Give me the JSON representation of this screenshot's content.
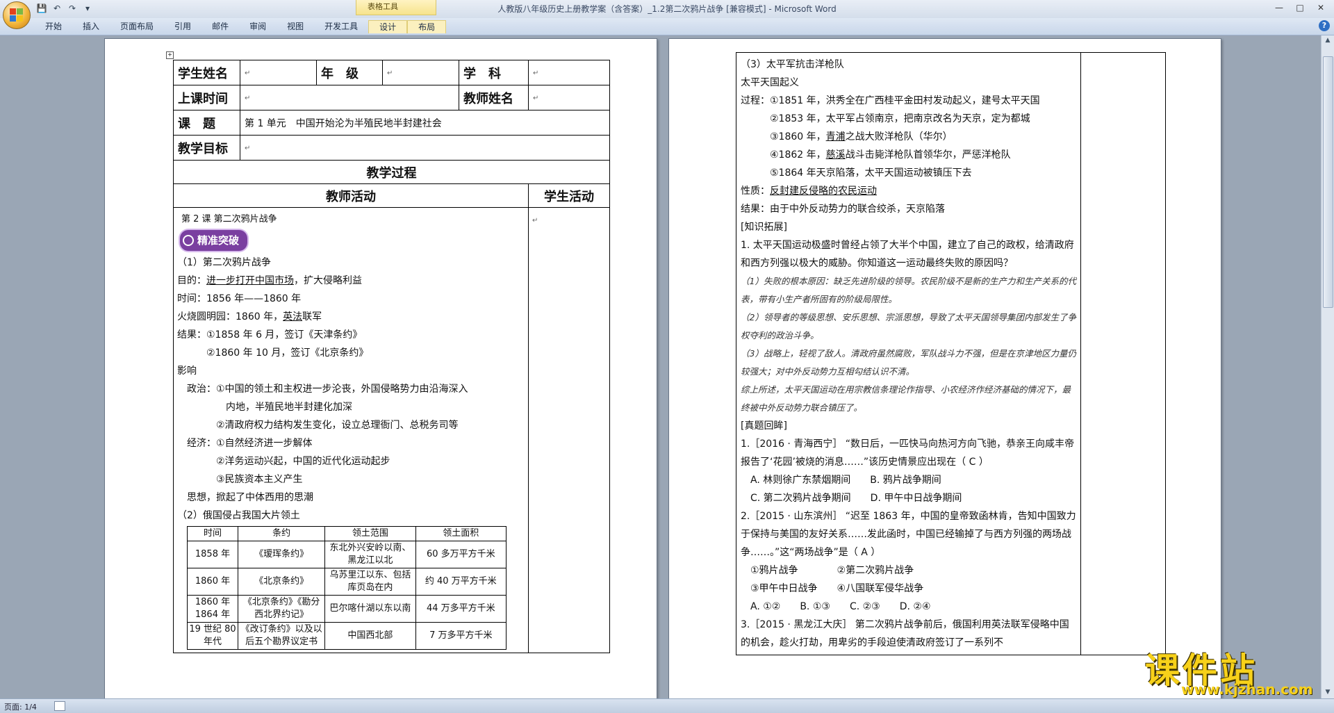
{
  "window": {
    "title": "人教版八年级历史上册教学案（含答案）_1.2第二次鸦片战争 [兼容模式] - Microsoft Word",
    "context_tab_group": "表格工具",
    "controls": [
      "—",
      "□",
      "✕"
    ]
  },
  "ribbon": {
    "tabs": [
      "开始",
      "插入",
      "页面布局",
      "引用",
      "邮件",
      "审阅",
      "视图",
      "开发工具"
    ],
    "context_tabs": [
      "设计",
      "布局"
    ]
  },
  "qat": {
    "save": "💾",
    "undo": "↶",
    "redo": "↷",
    "more": "▾"
  },
  "status": {
    "page": "页面: 1/4"
  },
  "page1": {
    "student_name_label": "学生姓名",
    "grade_label": "年　级",
    "subject_label": "学　科",
    "class_time_label": "上课时间",
    "teacher_name_label": "教师姓名",
    "topic_label": "课　题",
    "topic_value": "第 1 单元　中国开始沦为半殖民地半封建社会",
    "goal_label": "教学目标",
    "process_title": "教学过程",
    "teacher_activity": "教师活动",
    "student_activity": "学生活动",
    "lesson_title": "第 2 课 第二次鸦片战争",
    "badge": "精准突破",
    "lines": {
      "s1": "（1）第二次鸦片战争",
      "purpose_pre": "目的：",
      "purpose_u": "进一步打开中国市场",
      "purpose_post": "，扩大侵略利益",
      "time": "时间：1856 年——1860 年",
      "burn_pre": "火烧圆明园：1860 年，",
      "burn_u": "英法",
      "burn_post": "联军",
      "res1": "结果：①1858 年 6 月，签订《天津条约》",
      "res2": "②1860 年 10 月，签订《北京条约》",
      "impact": "影响",
      "pol1": "政治：①中国的领土和主权进一步沦丧，外国侵略势力由沿海深入",
      "pol1b": "内地，半殖民地半封建化加深",
      "pol2": "②清政府权力结构发生变化，设立总理衙门、总税务司等",
      "eco1": "经济：①自然经济进一步解体",
      "eco2": "②洋务运动兴起，中国的近代化运动起步",
      "eco3": "③民族资本主义产生",
      "thought": "思想，掀起了中体西用的思潮",
      "s2": "（2）俄国侵占我国大片领土"
    },
    "table_headers": [
      "时间",
      "条约",
      "领土范围",
      "领土面积"
    ],
    "table_rows": [
      {
        "time": "1858 年",
        "treaty": "《瑷珲条约》",
        "range": "东北外兴安岭以南、黑龙江以北",
        "area": "60 多万平方千米"
      },
      {
        "time": "1860 年",
        "treaty": "《北京条约》",
        "range": "乌苏里江以东、包括库页岛在内",
        "area": "约 40 万平方千米"
      },
      {
        "time": "1860 年 1864 年",
        "treaty": "《北京条约》《勘分西北界约记》",
        "range": "巴尔喀什湖以东以南",
        "area": "44 万多平方千米"
      },
      {
        "time": "19 世纪 80 年代",
        "treaty": "《改订条约》以及以后五个勘界议定书",
        "range": "中国西北部",
        "area": "7 万多平方千米"
      }
    ]
  },
  "page2": {
    "lines": {
      "h3": "（3）太平军抗击洋枪队",
      "taiping": "太平天国起义",
      "proc1": "过程：①1851 年，洪秀全在广西桂平金田村发动起义，建号太平天国",
      "proc2": "②1853 年，太平军占领南京，把南京改名为天京，定为都城",
      "proc3a": "③1860 年，",
      "proc3u": "青浦",
      "proc3b": "之战大败洋枪队（华尔）",
      "proc4a": "④1862 年，",
      "proc4u": "慈溪",
      "proc4b": "战斗击毙洋枪队首领华尔，严惩洋枪队",
      "proc5": "⑤1864 年天京陷落，太平天国运动被镇压下去",
      "nature_pre": "性质：",
      "nature_u": "反封建反侵略的农民运动",
      "result": "结果：由于中外反动势力的联合绞杀，天京陷落",
      "ext": "[知识拓展]",
      "q1": "1. 太平天国运动极盛时曾经占领了大半个中国，建立了自己的政权，给清政府和西方列强以极大的威胁。你知道这一运动最终失败的原因吗？",
      "a1": "（1）失败的根本原因：缺乏先进阶级的领导。农民阶级不是新的生产力和生产关系的代表，带有小生产者所固有的阶级局限性。",
      "a2": "（2）领导者的等级思想、安乐思想、宗派思想，导致了太平天国领导集团内部发生了争权夺利的政治斗争。",
      "a3": "（3）战略上，轻视了敌人。清政府虽然腐败，军队战斗力不强，但是在京津地区力量仍较强大；对中外反动势力互相勾结认识不清。",
      "a4": "综上所述，太平天国运动在用宗教信条理论作指导、小农经济作经济基础的情况下，最终被中外反动势力联合镇压了。",
      "review": "[真题回眸]",
      "e1": "1.［2016 · 青海西宁］ “数日后，一匹快马向热河方向飞驰，恭亲王向咸丰帝报告了‘花园’被烧的消息……”该历史情景应出现在（ C ）",
      "e1ab": "A. 林则徐广东禁烟期间　　B. 鸦片战争期间",
      "e1cd": "C. 第二次鸦片战争期间　　D. 甲午中日战争期间",
      "e2": "2.［2015 · 山东滨州］ “迟至 1863 年，中国的皇帝致函林肯，告知中国致力于保持与美国的友好关系……发此函时，中国已经输掉了与西方列强的两场战争……。”这“两场战争”是（ A ）",
      "e2o1": "①鸦片战争　　　　②第二次鸦片战争",
      "e2o2": "③甲午中日战争　　④八国联军侵华战争",
      "e2ans": "A. ①②　　B. ①③　　C. ②③　　D. ②④",
      "e3": "3.［2015 · 黑龙江大庆］ 第二次鸦片战争前后，俄国利用英法联军侵略中国的机会，趁火打劫，用卑劣的手段迫使清政府签订了一系列不"
    }
  },
  "watermark": {
    "text": "课件站",
    "url": "www.kjzhan.com"
  },
  "colors": {
    "badge": "#7a3fa0",
    "watermark": "#f7d11a",
    "workspace": "#9aa6b5"
  }
}
